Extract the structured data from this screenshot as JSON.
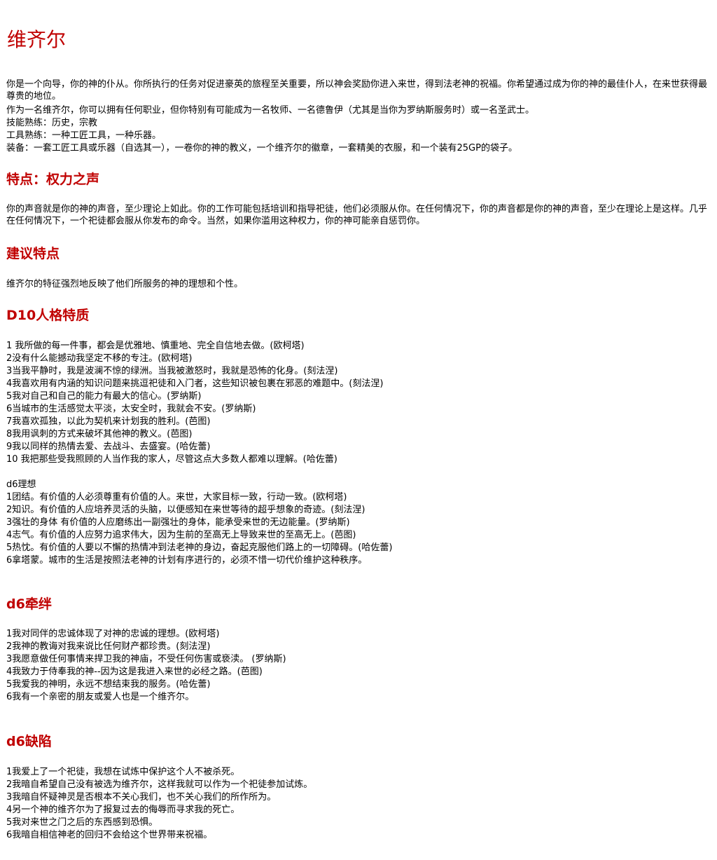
{
  "document": {
    "title": "维齐尔",
    "intro": {
      "paragraph": "你是一个向导，你的神的仆从。你所执行的任务对促进豪英的旅程至关重要，所以神会奖励你进入来世，得到法老神的祝福。你希望通过成为你的神的最佳仆人，在来世获得最尊贵的地位。",
      "lines": [
        "作为一名维齐尔，你可以拥有任何职业，但你特别有可能成为一名牧师、一名德鲁伊（尤其是当你为罗纳斯服务时）或一名圣武士。",
        "技能熟练：历史，宗教",
        "工具熟练：一种工匠工具，一种乐器。",
        "装备：一套工匠工具或乐器（自选其一），一卷你的神的教义，一个维齐尔的徽章，一套精美的衣服，和一个装有25GP的袋子。"
      ]
    },
    "feature": {
      "heading": "特点：权力之声",
      "paragraph": "你的声音就是你的神的声音，至少理论上如此。你的工作可能包括培训和指导祀徒，他们必须服从你。在任何情况下，你的声音都是你的神的声音，至少在理论上是这样。几乎在任何情况下，一个祀徒都会服从你发布的命令。当然，如果你滥用这种权力，你的神可能亲自惩罚你。"
    },
    "suggested": {
      "heading": "建议特点",
      "text": "维齐尔的特征强烈地反映了他们所服务的神的理想和个性。"
    },
    "personality": {
      "heading": "D10人格特质",
      "items": [
        "1 我所做的每一件事，都会是优雅地、慎重地、完全自信地去做。(欧柯塔)",
        "2没有什么能撼动我坚定不移的专注。(欧柯塔)",
        "3当我平静时，我是波澜不惊的绿洲。当我被激怒时，我就是恐怖的化身。(刻法涅)",
        "4我喜欢用有内涵的知识问题来挑逗祀徒和入门者，这些知识被包裹在邪恶的难题中。(刻法涅)",
        "5我对自己和自己的能力有最大的信心。(罗纳斯)",
        "6当城市的生活感觉太平淡，太安全时，我就会不安。(罗纳斯)",
        "7我喜欢孤独，以此为契机来计划我的胜利。(芭图)",
        "8我用讽刺的方式来破坏其他神的教义。(芭图)",
        "9我以同样的热情去爱、去战斗、去盛宴。(哈佐蕾)",
        "10 我把那些受我照顾的人当作我的家人，尽管这点大多数人都难以理解。(哈佐蕾)"
      ]
    },
    "ideals": {
      "label": "d6理想",
      "items": [
        "1团结。有价值的人必须尊重有价值的人。来世，大家目标一致，行动一致。(欧柯塔)",
        "2知识。有价值的人应培养灵活的头脑，以便感知在来世等待的超乎想象的奇迹。(刻法涅)",
        "3强壮的身体 有价值的人应磨练出一副强壮的身体，能承受来世的无边能量。(罗纳斯)",
        "4志气。有价值的人应努力追求伟大，因为生前的至高无上导致来世的至高无上。(芭图)",
        "5热忱。有价值的人要以不懈的热情冲到法老神的身边，奋起克服他们路上的一切障碍。(哈佐蕾)",
        "6拿塔蒙。城市的生活是按照法老神的计划有序进行的，必须不惜一切代价维护这种秩序。"
      ]
    },
    "bonds": {
      "heading": "d6牵绊",
      "items": [
        "1我对同伴的忠诚体现了对神的忠诚的理想。(欧柯塔)",
        "2我神的教诲对我来说比任何财产都珍贵。(刻法涅)",
        "3我愿意做任何事情来捍卫我的神庙，不受任何伤害或亵渎。 (罗纳斯)",
        "4我致力于侍奉我的神--因为这是我进入来世的必经之路。(芭图)",
        "5我爱我的神明，永远不想结束我的服务。(哈佐蕾)",
        "6我有一个亲密的朋友或爱人也是一个维齐尔。"
      ]
    },
    "flaws": {
      "heading": "d6缺陷",
      "items": [
        "1我爱上了一个祀徒，我想在试炼中保护这个人不被杀死。",
        "2我暗自希望自己没有被选为维齐尔，这样我就可以作为一个祀徒参加试炼。",
        "3我暗自怀疑神灵是否根本不关心我们，也不关心我们的所作所为。",
        "4另一个神的维齐尔为了报复过去的侮辱而寻求我的死亡。",
        "5我对来世之门之后的东西感到恐惧。",
        "6我暗自相信神老的回归不会给这个世界带来祝福。"
      ]
    },
    "colors": {
      "heading": "#c00000",
      "text": "#000000",
      "background": "#ffffff"
    }
  }
}
